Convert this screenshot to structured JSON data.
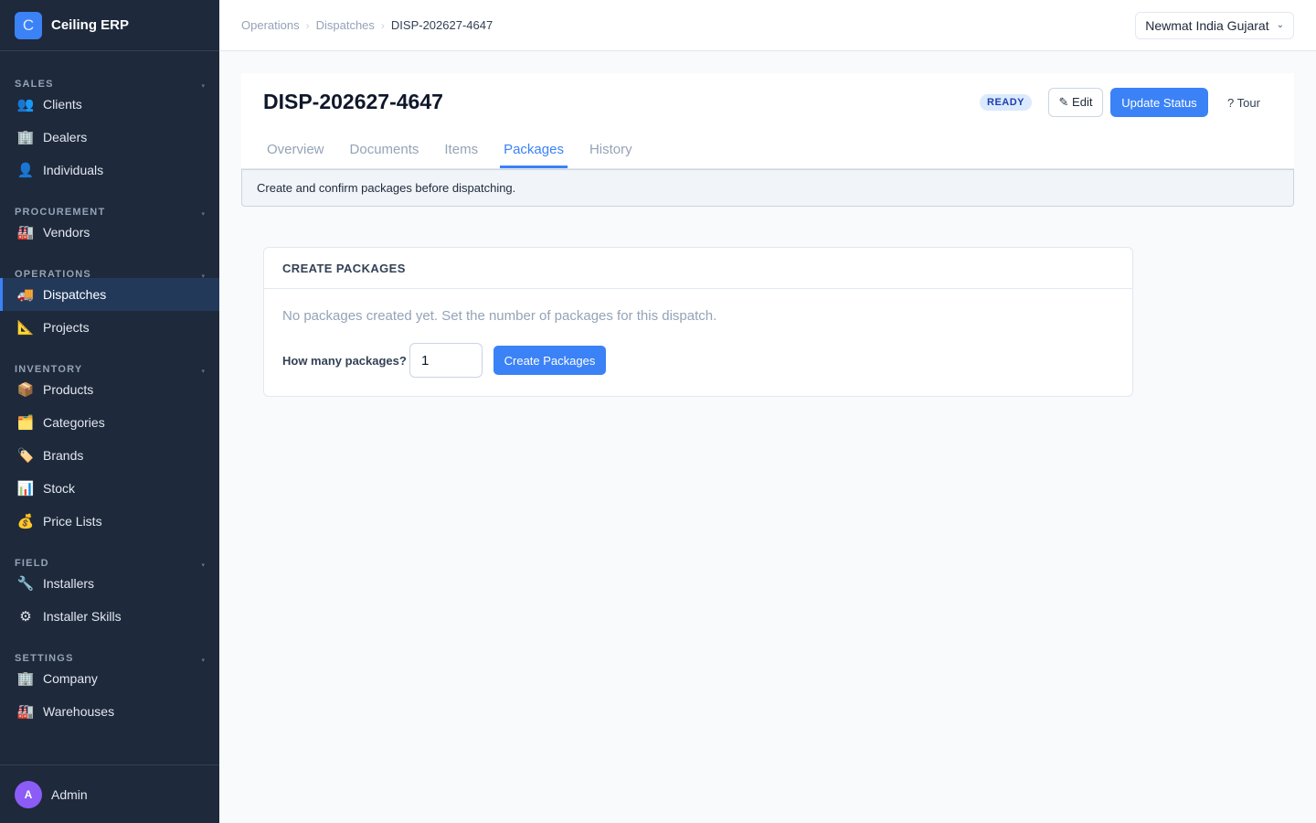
{
  "brand": {
    "logo_letter": "C",
    "name": "Ceiling ERP"
  },
  "sidebar": {
    "sections": [
      {
        "label": "SALES"
      },
      {
        "label": "PROCUREMENT"
      },
      {
        "label": "OPERATIONS"
      },
      {
        "label": "INVENTORY"
      },
      {
        "label": "FIELD"
      },
      {
        "label": "SETTINGS"
      }
    ],
    "items": [
      {
        "label": "Clients",
        "icon": "👥"
      },
      {
        "label": "Dealers",
        "icon": "🏢"
      },
      {
        "label": "Individuals",
        "icon": "👤"
      },
      {
        "label": "Vendors",
        "icon": "🏭"
      },
      {
        "label": "Dispatches",
        "icon": "🚚"
      },
      {
        "label": "Projects",
        "icon": "📐"
      },
      {
        "label": "Products",
        "icon": "📦"
      },
      {
        "label": "Categories",
        "icon": "🗂️"
      },
      {
        "label": "Brands",
        "icon": "🏷️"
      },
      {
        "label": "Stock",
        "icon": "📊"
      },
      {
        "label": "Price Lists",
        "icon": "💰"
      },
      {
        "label": "Installers",
        "icon": "🔧"
      },
      {
        "label": "Installer Skills",
        "icon": "⚙"
      },
      {
        "label": "Company",
        "icon": "🏢"
      },
      {
        "label": "Warehouses",
        "icon": "🏭"
      }
    ],
    "active_item": "Dispatches",
    "caret": "▾",
    "user": {
      "initial": "A",
      "name": "Admin"
    }
  },
  "topbar": {
    "breadcrumb": [
      "Operations",
      "Dispatches",
      "DISP-202627-4647"
    ],
    "separator": "›",
    "company": "Newmat India Gujarat",
    "company_caret": "⌄"
  },
  "header": {
    "title": "DISP-202627-4647",
    "status": "READY",
    "edit_label": "✎ Edit",
    "update_label": "Update Status",
    "tour_label": "? Tour",
    "tabs": [
      "Overview",
      "Documents",
      "Items",
      "Packages",
      "History"
    ],
    "active_tab": "Packages"
  },
  "info": {
    "text": "Create and confirm packages before dispatching."
  },
  "packages": {
    "title": "CREATE PACKAGES",
    "empty_text": "No packages created yet. Set the number of packages for this dispatch.",
    "count_label": "How many packages?",
    "count_value": "1",
    "create_label": "Create Packages"
  },
  "colors": {
    "accent": "#3b82f6",
    "sidebar_bg": "#1e293b",
    "badge_bg": "#dbeafe",
    "avatar": "#8b5cf6"
  }
}
